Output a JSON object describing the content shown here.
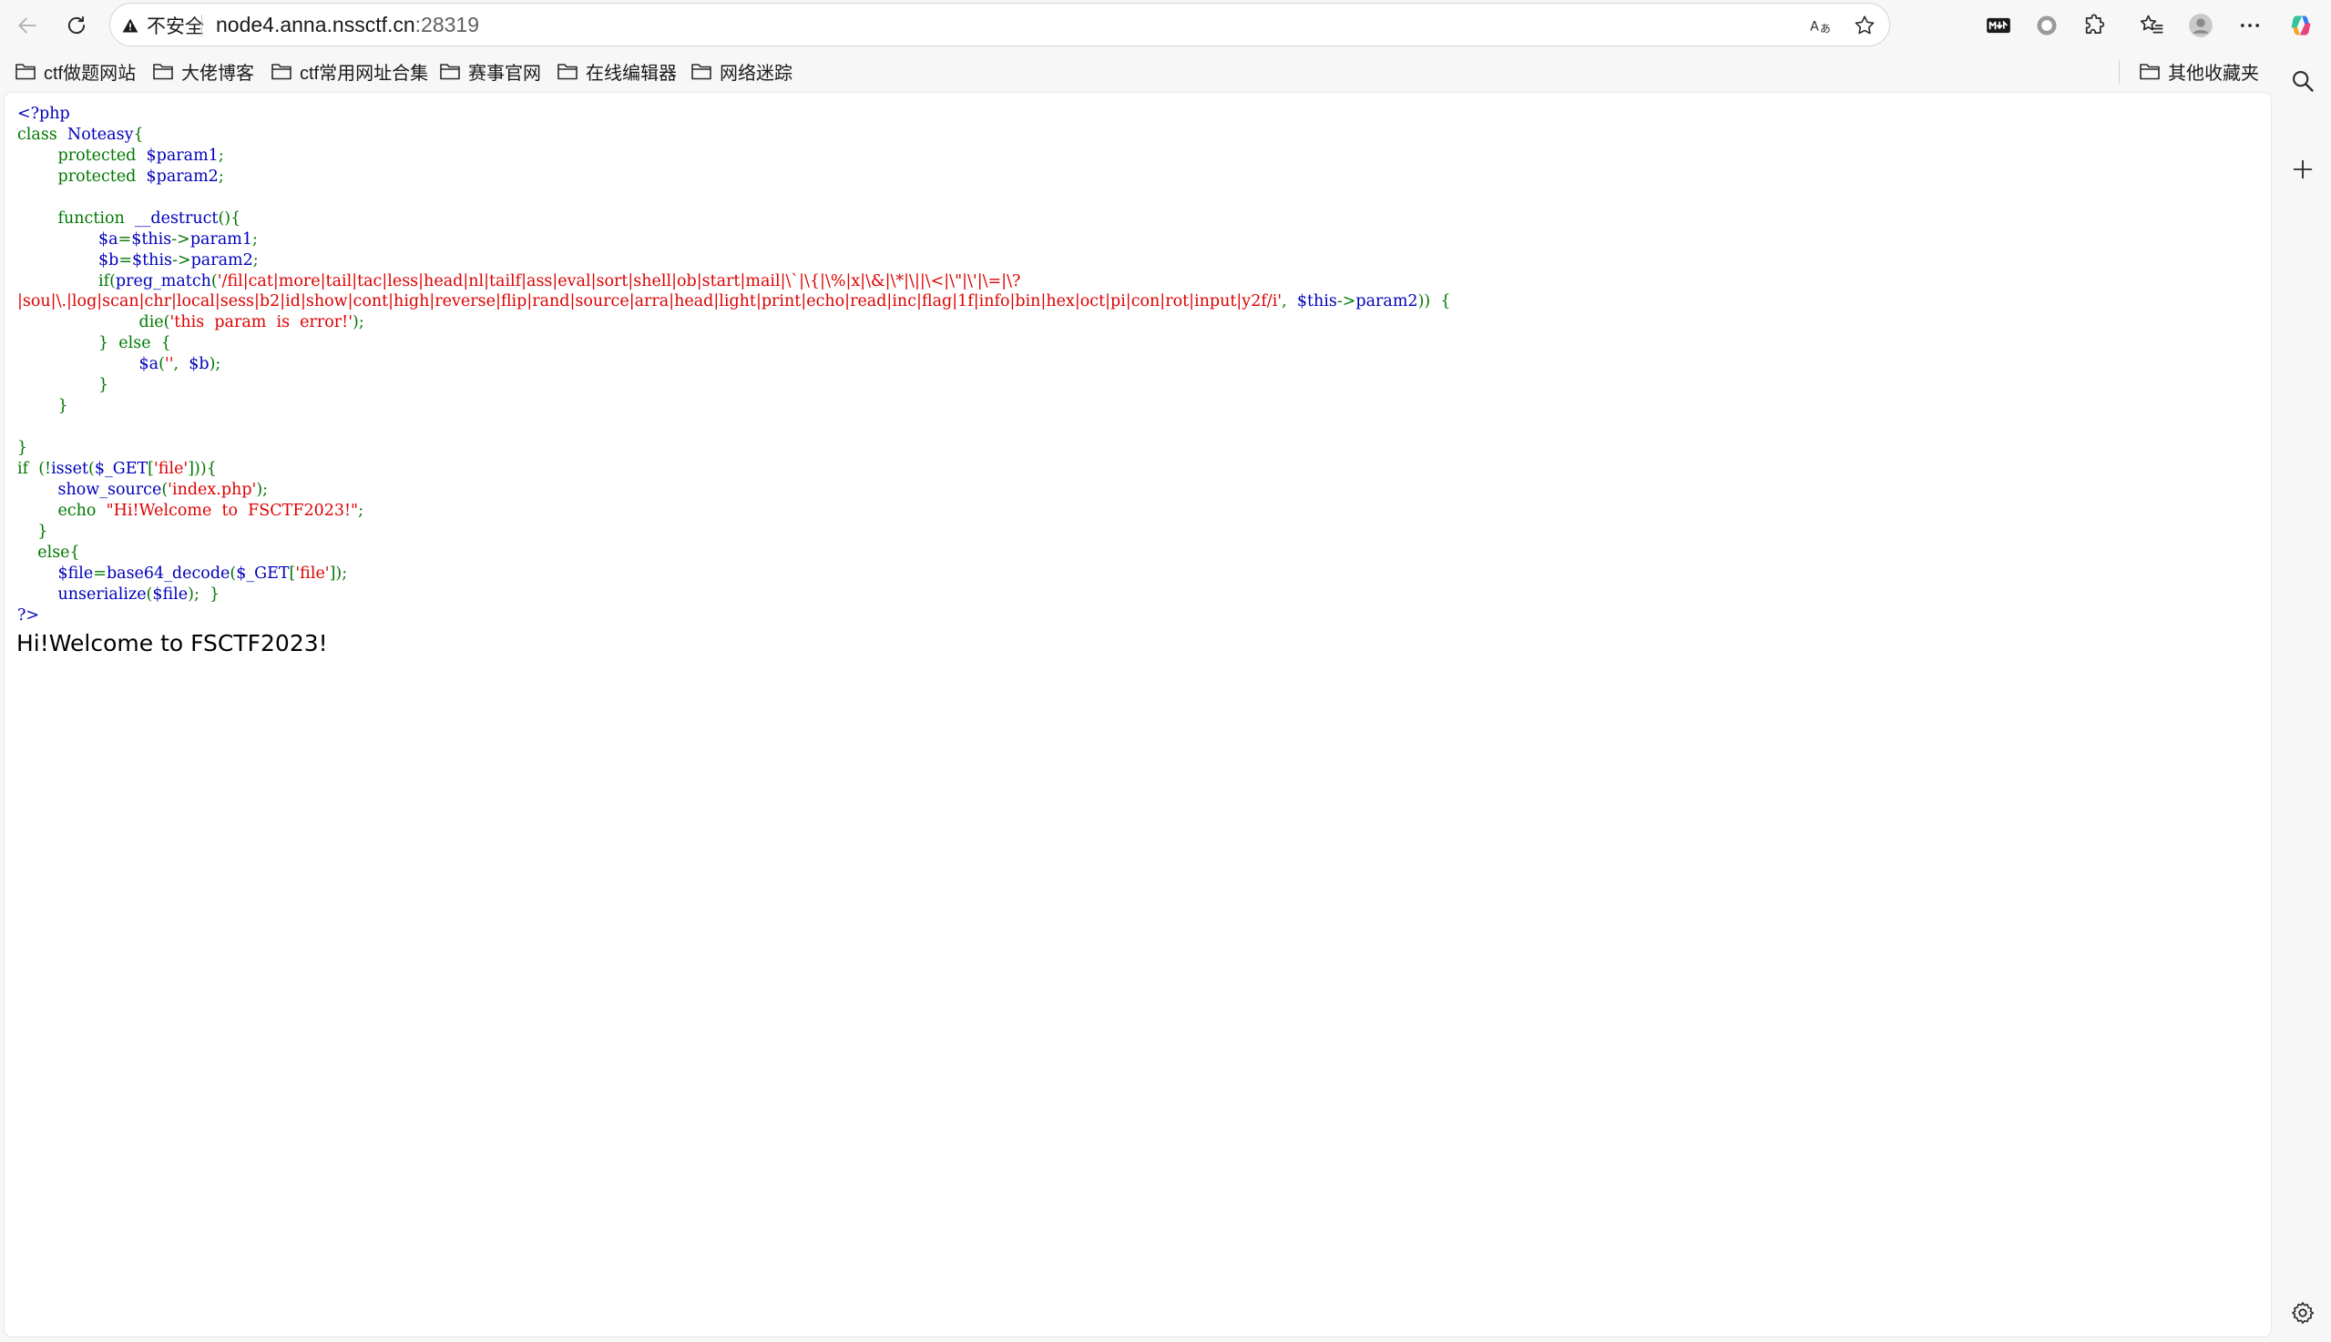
{
  "browser": {
    "security_label": "不安全",
    "url_host": "node4.anna.nssctf.cn",
    "url_port": ":28319",
    "bookmarks": [
      "ctf做题网站",
      "大佬博客",
      "ctf常用网址合集",
      "赛事官网",
      "在线编辑器",
      "网络迷踪"
    ],
    "other_bookmarks": "其他收藏夹"
  },
  "code": {
    "l1": [
      [
        "d",
        "<?php"
      ]
    ],
    "l2": [
      [
        "k",
        "class  "
      ],
      [
        "d",
        "Noteasy"
      ],
      [
        "k",
        "{"
      ]
    ],
    "l3": [
      [
        "k",
        "        protected  "
      ],
      [
        "d",
        "$param1"
      ],
      [
        "k",
        ";"
      ]
    ],
    "l4": [
      [
        "k",
        "        protected  "
      ],
      [
        "d",
        "$param2"
      ],
      [
        "k",
        ";"
      ]
    ],
    "l5": [
      [
        "k",
        " "
      ]
    ],
    "l6": [
      [
        "k",
        "        function  "
      ],
      [
        "d",
        "__destruct"
      ],
      [
        "k",
        "(){"
      ]
    ],
    "l7": [
      [
        "d",
        "                $a"
      ],
      [
        "k",
        "="
      ],
      [
        "d",
        "$this"
      ],
      [
        "k",
        "->"
      ],
      [
        "d",
        "param1"
      ],
      [
        "k",
        ";"
      ]
    ],
    "l8": [
      [
        "d",
        "                $b"
      ],
      [
        "k",
        "="
      ],
      [
        "d",
        "$this"
      ],
      [
        "k",
        "->"
      ],
      [
        "d",
        "param2"
      ],
      [
        "k",
        ";"
      ]
    ],
    "l9": [
      [
        "k",
        "                if("
      ],
      [
        "d",
        "preg_match"
      ],
      [
        "k",
        "("
      ],
      [
        "s",
        "'/fil|cat|more|tail|tac|less|head|nl|tailf|ass|eval|sort|shell|ob|start|mail|\\`|\\{|\\%|x|\\&|\\*|\\||\\<|\\\"|\\'|\\=|\\?"
      ]
    ],
    "l10": [
      [
        "s",
        "|sou|\\.|log|scan|chr|local|sess|b2|id|show|cont|high|reverse|flip|rand|source|arra|head|light|print|echo|read|inc|flag|1f|info|bin|hex|oct|pi|con|rot|input|y2f/i'"
      ],
      [
        "k",
        ",  "
      ],
      [
        "d",
        "$this"
      ],
      [
        "k",
        "->"
      ],
      [
        "d",
        "param2"
      ],
      [
        "k",
        "))  {"
      ]
    ],
    "l11": [
      [
        "k",
        "                        die("
      ],
      [
        "s",
        "'this  param  is  error!'"
      ],
      [
        "k",
        ");"
      ]
    ],
    "l12": [
      [
        "k",
        "                }  else  {"
      ]
    ],
    "l13": [
      [
        "d",
        "                        $a"
      ],
      [
        "k",
        "("
      ],
      [
        "s",
        "''"
      ],
      [
        "k",
        ",  "
      ],
      [
        "d",
        "$b"
      ],
      [
        "k",
        ");"
      ]
    ],
    "l14": [
      [
        "k",
        "                }"
      ]
    ],
    "l15": [
      [
        "k",
        "        }"
      ]
    ],
    "l16": [
      [
        "k",
        " "
      ]
    ],
    "l17": [
      [
        "k",
        "}"
      ]
    ],
    "l18": [
      [
        "k",
        "if  (!"
      ],
      [
        "d",
        "isset"
      ],
      [
        "k",
        "("
      ],
      [
        "d",
        "$_GET"
      ],
      [
        "k",
        "["
      ],
      [
        "s",
        "'file'"
      ],
      [
        "k",
        "])){"
      ]
    ],
    "l19": [
      [
        "d",
        "        show_source"
      ],
      [
        "k",
        "("
      ],
      [
        "s",
        "'index.php'"
      ],
      [
        "k",
        ");"
      ]
    ],
    "l20": [
      [
        "k",
        "        echo  "
      ],
      [
        "s",
        "\"Hi!Welcome  to  FSCTF2023!\""
      ],
      [
        "k",
        ";"
      ]
    ],
    "l21": [
      [
        "k",
        "    }"
      ]
    ],
    "l22": [
      [
        "k",
        "    else{"
      ]
    ],
    "l23": [
      [
        "d",
        "        $file"
      ],
      [
        "k",
        "="
      ],
      [
        "d",
        "base64_decode"
      ],
      [
        "k",
        "("
      ],
      [
        "d",
        "$_GET"
      ],
      [
        "k",
        "["
      ],
      [
        "s",
        "'file'"
      ],
      [
        "k",
        "]);"
      ]
    ],
    "l24": [
      [
        "d",
        "        unserialize"
      ],
      [
        "k",
        "("
      ],
      [
        "d",
        "$file"
      ],
      [
        "k",
        ");  }"
      ]
    ],
    "l25": [
      [
        "d",
        "?>"
      ]
    ]
  },
  "output_text": "Hi!Welcome to FSCTF2023!",
  "colors": {
    "php_default": "#0000bb",
    "php_keyword": "#007700",
    "php_string": "#dd0000",
    "warning_icon": "#1a1a1a"
  }
}
